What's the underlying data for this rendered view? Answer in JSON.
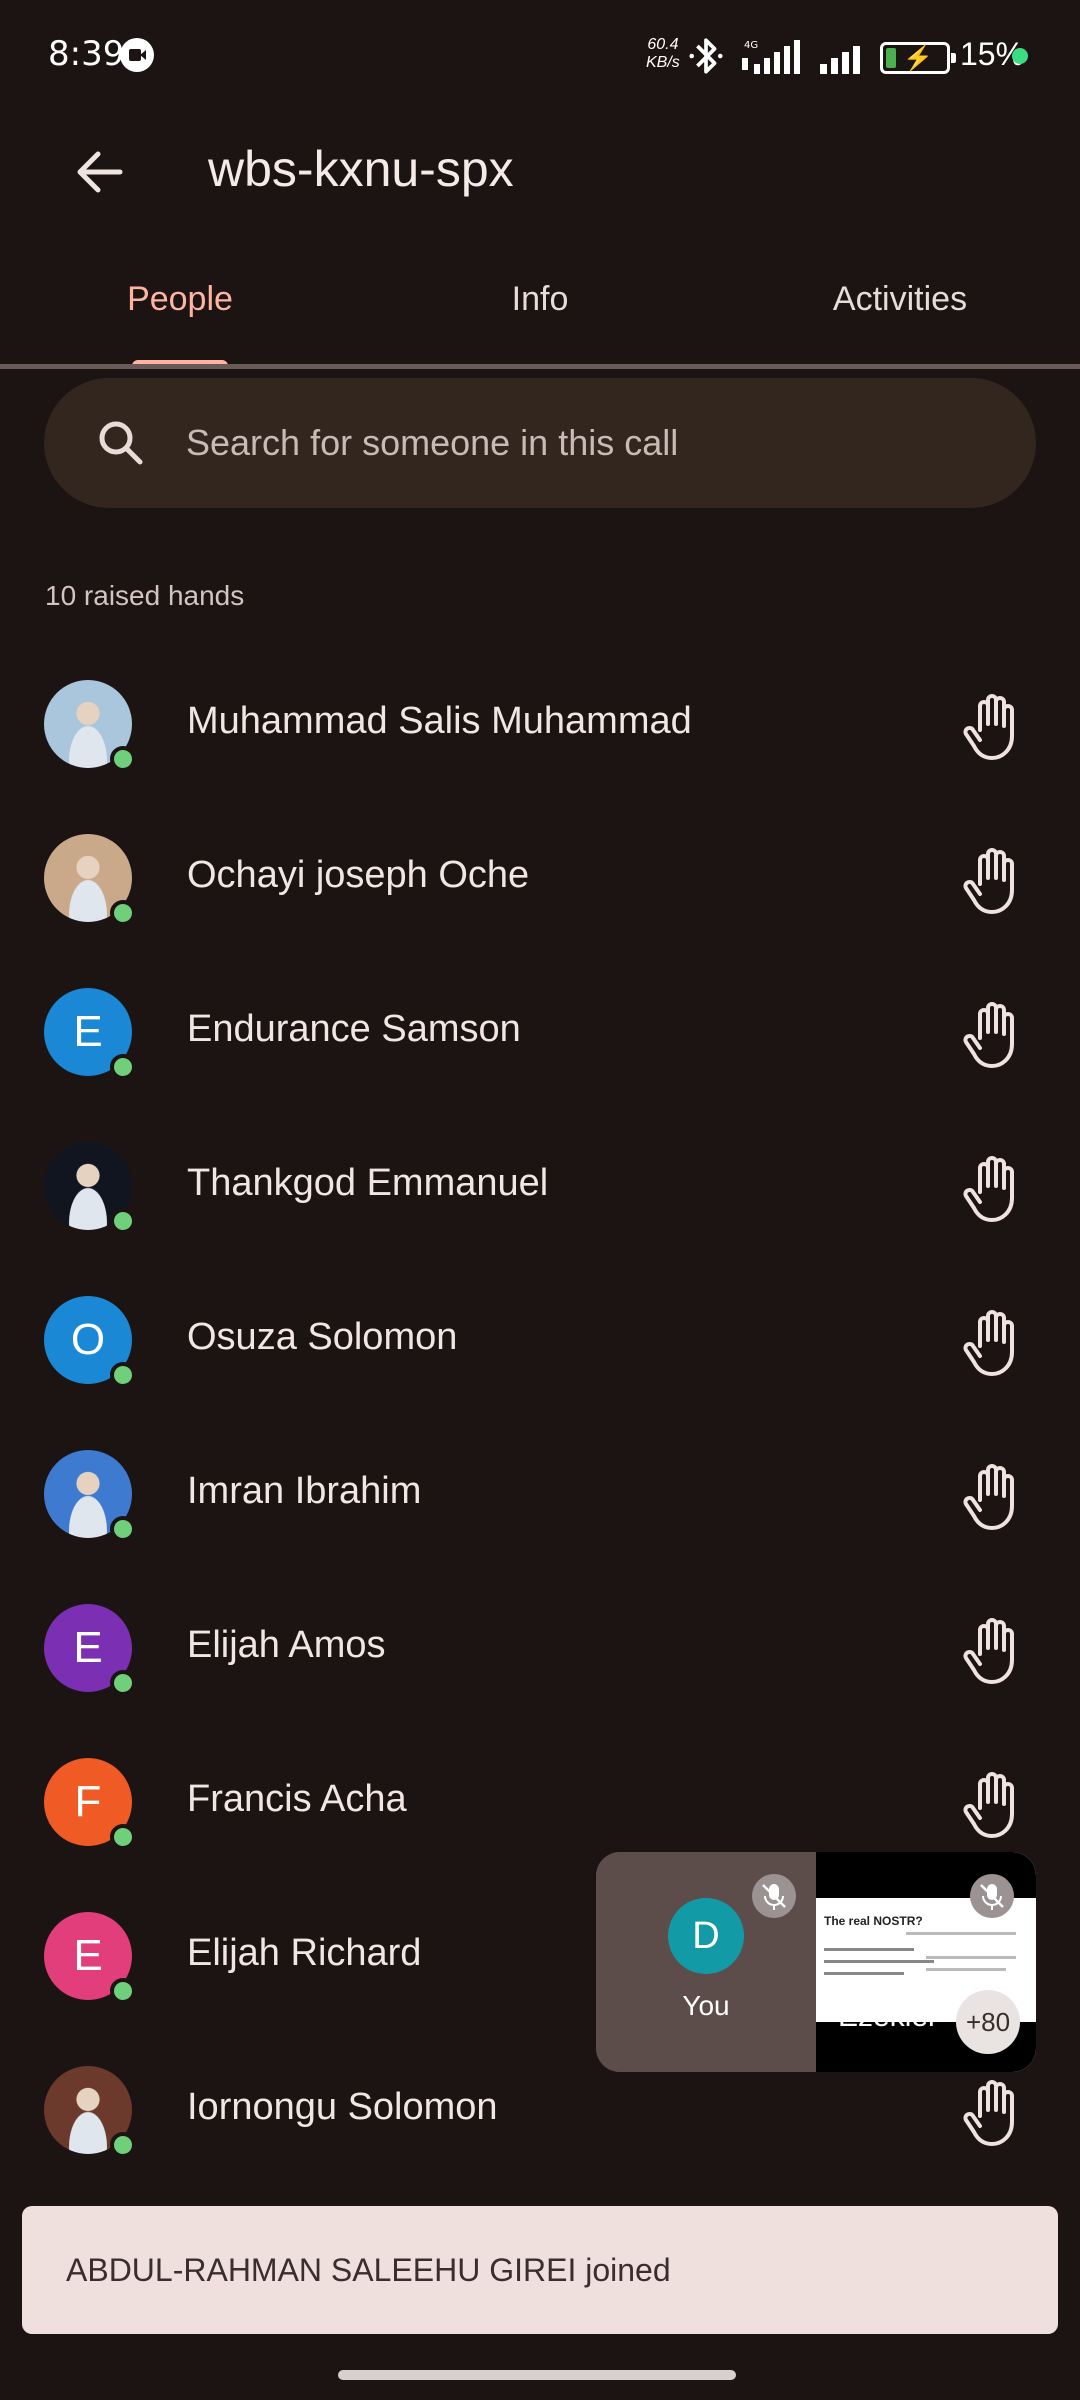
{
  "status_bar": {
    "time": "8:39",
    "net_speed_value": "60.4",
    "net_speed_unit": "KB/s",
    "network_type": "4G",
    "battery_percent": "15%",
    "battery_level": 0.15,
    "icons": [
      "screen-record-icon",
      "bluetooth-icon",
      "signal-icon",
      "signal-icon",
      "battery-charging-icon"
    ]
  },
  "header": {
    "title": "wbs-kxnu-spx"
  },
  "tabs": [
    {
      "label": "People",
      "active": true
    },
    {
      "label": "Info",
      "active": false
    },
    {
      "label": "Activities",
      "active": false
    }
  ],
  "search": {
    "placeholder": "Search for someone in this call"
  },
  "section": {
    "label": "10 raised hands"
  },
  "people": [
    {
      "name": "Muhammad Salis Muhammad",
      "avatar_type": "photo",
      "avatar_color": "#a9c6dc"
    },
    {
      "name": "Ochayi joseph Oche",
      "avatar_type": "photo",
      "avatar_color": "#c9a98a"
    },
    {
      "name": "Endurance Samson",
      "avatar_type": "letter",
      "initial": "E",
      "avatar_color": "#1a88d4"
    },
    {
      "name": "Thankgod Emmanuel",
      "avatar_type": "photo",
      "avatar_color": "#101520"
    },
    {
      "name": "Osuza Solomon",
      "avatar_type": "letter",
      "initial": "O",
      "avatar_color": "#1a88d4"
    },
    {
      "name": "Imran Ibrahim",
      "avatar_type": "photo",
      "avatar_color": "#3f7ad1"
    },
    {
      "name": "Elijah Amos",
      "avatar_type": "letter",
      "initial": "E",
      "avatar_color": "#7b2fb3"
    },
    {
      "name": "Francis Acha",
      "avatar_type": "letter",
      "initial": "F",
      "avatar_color": "#f05a24"
    },
    {
      "name": "Elijah Richard",
      "avatar_type": "letter",
      "initial": "E",
      "avatar_color": "#e33e7c"
    },
    {
      "name": "Iornongu Solomon",
      "avatar_type": "photo",
      "avatar_color": "#6b3a2c"
    }
  ],
  "pip": {
    "self_initial": "D",
    "self_label": "You",
    "other_name": "Ezekiel",
    "more_count": "+80",
    "slide_title": "The real NOSTR?"
  },
  "toast": {
    "message": "ABDUL-RAHMAN SALEEHU GIREI joined"
  },
  "colors": {
    "background": "#1c1413",
    "accent": "#ffb4a2",
    "online": "#6fcf7b"
  }
}
